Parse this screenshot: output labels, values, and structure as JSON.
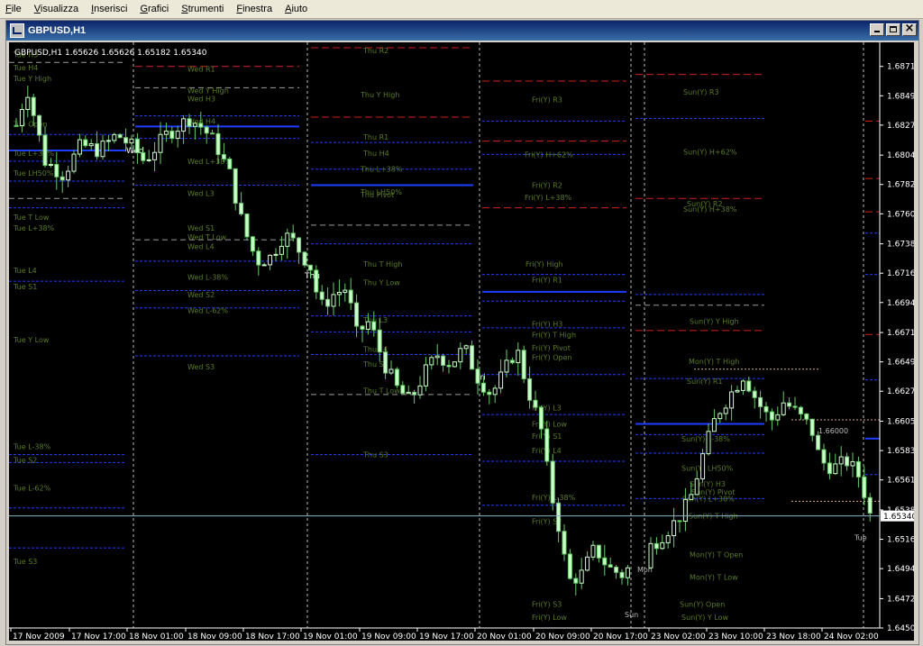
{
  "menu": [
    "File",
    "Visualizza",
    "Inserisci",
    "Grafici",
    "Strumenti",
    "Finestra",
    "Aiuto"
  ],
  "window": {
    "title": "GBPUSD,H1"
  },
  "info_line": "GBPUSD,H1  1.65626 1.65626 1.65182 1.65340",
  "colors": {
    "background": "#000000",
    "bull": "#ccffcc",
    "bear": "#66cc66",
    "grid": "#ffffff",
    "blue_line": "#1f3cff",
    "red_line": "#d02020",
    "label": "#5a7a2a",
    "current_price_bg": "#ffffff"
  },
  "price_axis": {
    "ticks": [
      "1.68710",
      "1.68490",
      "1.68270",
      "1.68045",
      "1.67825",
      "1.67605",
      "1.67380",
      "1.67160",
      "1.66940",
      "1.66715",
      "1.66495",
      "1.66275",
      "1.66050",
      "1.65830",
      "1.65610",
      "1.65385",
      "1.65165",
      "1.64945",
      "1.64720",
      "1.64500"
    ],
    "current_price": "1.65340"
  },
  "time_axis": [
    "17 Nov 2009",
    "17 Nov 17:00",
    "18 Nov 01:00",
    "18 Nov 09:00",
    "18 Nov 17:00",
    "19 Nov 01:00",
    "19 Nov 09:00",
    "19 Nov 17:00",
    "20 Nov 01:00",
    "20 Nov 09:00",
    "20 Nov 17:00",
    "23 Nov 02:00",
    "23 Nov 10:00",
    "23 Nov 18:00",
    "24 Nov 02:00"
  ],
  "chart_data": {
    "type": "candlestick",
    "symbol": "GBPUSD",
    "timeframe": "H1",
    "ohlc_last": {
      "open": 1.65626,
      "high": 1.65626,
      "low": 1.65182,
      "close": 1.6534
    },
    "ylim": [
      1.645,
      1.6885
    ],
    "session_markers": [
      "Wed",
      "Thu",
      "Fri",
      "Sun",
      "Mon",
      "Tue"
    ],
    "pivot_labels": [
      "Tue H3",
      "Tue H4",
      "Tue Y High",
      "Tue Open",
      "Tue L+38%",
      "Tue LH50%",
      "Tue T Low",
      "Tue L+38%",
      "Tue L4",
      "Tue S1",
      "Tue Y Low",
      "Tue L-38%",
      "Tue S2",
      "Tue L-62%",
      "Tue S3",
      "Wed R1",
      "Wed H3",
      "Wed Y High",
      "Wed L+38%",
      "Wed H4",
      "Wed L3",
      "Wed T Low",
      "Wed S1",
      "Wed L4",
      "Wed L-38%",
      "Wed S2",
      "Wed L-62%",
      "Wed S3",
      "Thu R2",
      "Thu Y High",
      "Thu R1",
      "Thu H4",
      "Thu L+38%",
      "Thu LH50%",
      "Thu Pivot",
      "Thu T High",
      "Thu Y Low",
      "Thu L3",
      "Thu L4",
      "Thu S1",
      "Thu T Low",
      "Thu S3",
      "Fri(Y) R3",
      "Fri(Y) H+62%",
      "Fri(Y) R2",
      "Fri(Y) L+38%",
      "Fri(Y) High",
      "Fri(Y) R1",
      "Fri(Y) H3",
      "Fri(Y) T High",
      "Fri(Y) Pivot",
      "Fri(Y) Open",
      "Fri(Y) L3",
      "Fri(Y) Low",
      "Fri(Y) S1",
      "Fri(Y) L4",
      "Fri(Y) L-38%",
      "Fri(Y) S2",
      "Fri(Y) S3",
      "Fri(Y) Low",
      "Sun(Y) R3",
      "Sun(Y) H+62%",
      "Sun(Y) R2",
      "Sun(Y) H+38%",
      "Sun(Y) Y High",
      "Mon(Y) T High",
      "Sun(Y) R1",
      "Sun(Y) L-38%",
      "Sun(Y) LH50%",
      "Sun(Y) H3",
      "Sun(Y) Pivot",
      "Sun(Y) L+38%",
      "Sun(Y) T High",
      "Mon(Y) T Open",
      "Mon(Y) T Low",
      "Sun(Y) Open",
      "Sun(Y) Y Low",
      "Mon",
      "Tue",
      "Sun",
      "1.66000"
    ]
  }
}
